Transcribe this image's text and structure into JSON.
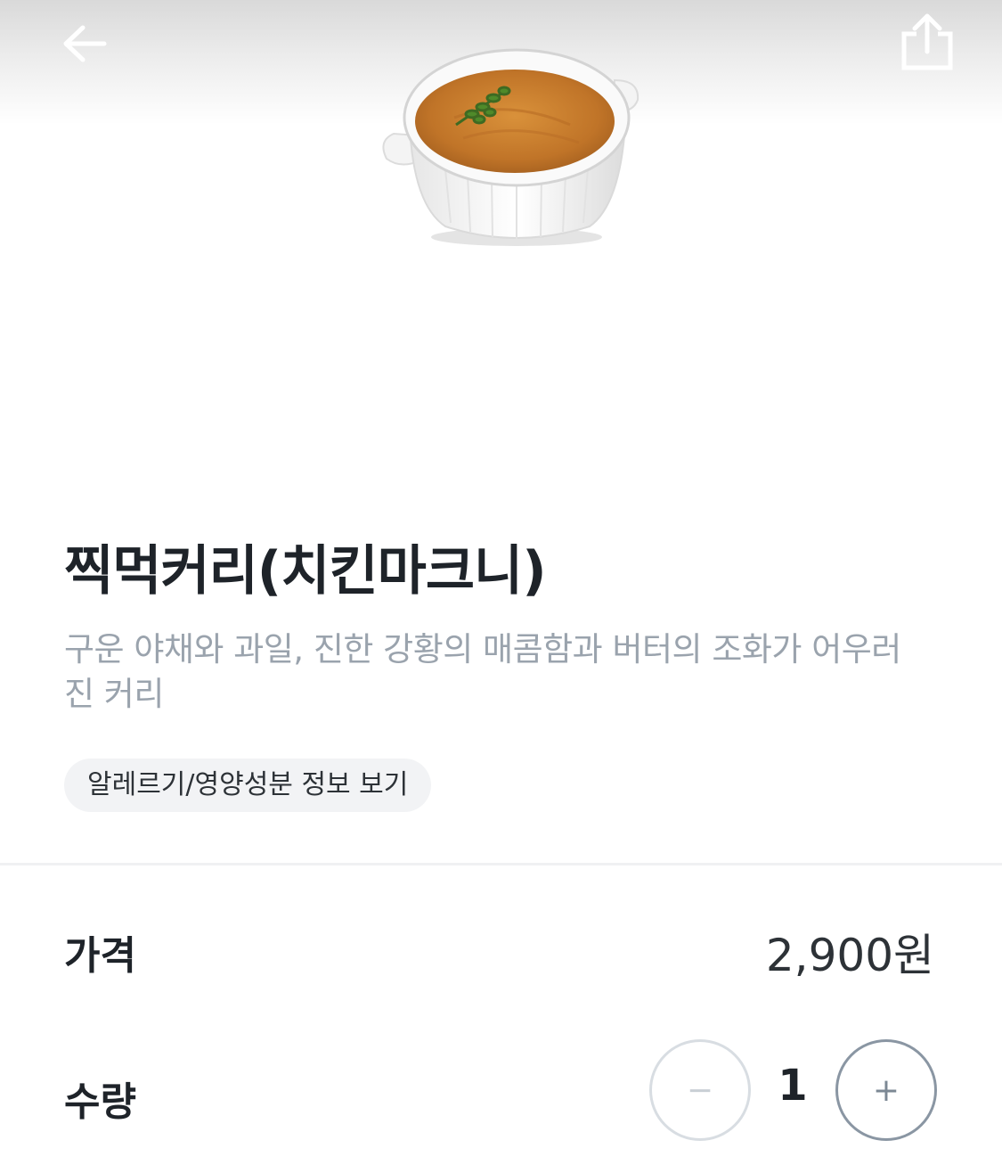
{
  "header": {
    "back_icon": "arrow-left-icon",
    "share_icon": "share-icon"
  },
  "product": {
    "name": "찍먹커리(치킨마크니)",
    "description": "구운 야채와 과일, 진한 강황의 매콤함과 버터의 조화가 어우러진 커리",
    "allergy_button_label": "알레르기/영양성분 정보 보기"
  },
  "price": {
    "label": "가격",
    "value": "2,900원"
  },
  "quantity": {
    "label": "수량",
    "value": "1",
    "minus_label": "−",
    "plus_label": "+"
  },
  "colors": {
    "title": "#1e2329",
    "description": "#9aa3ad",
    "chip_bg": "#f2f3f5",
    "curry": "#c87a2c"
  }
}
